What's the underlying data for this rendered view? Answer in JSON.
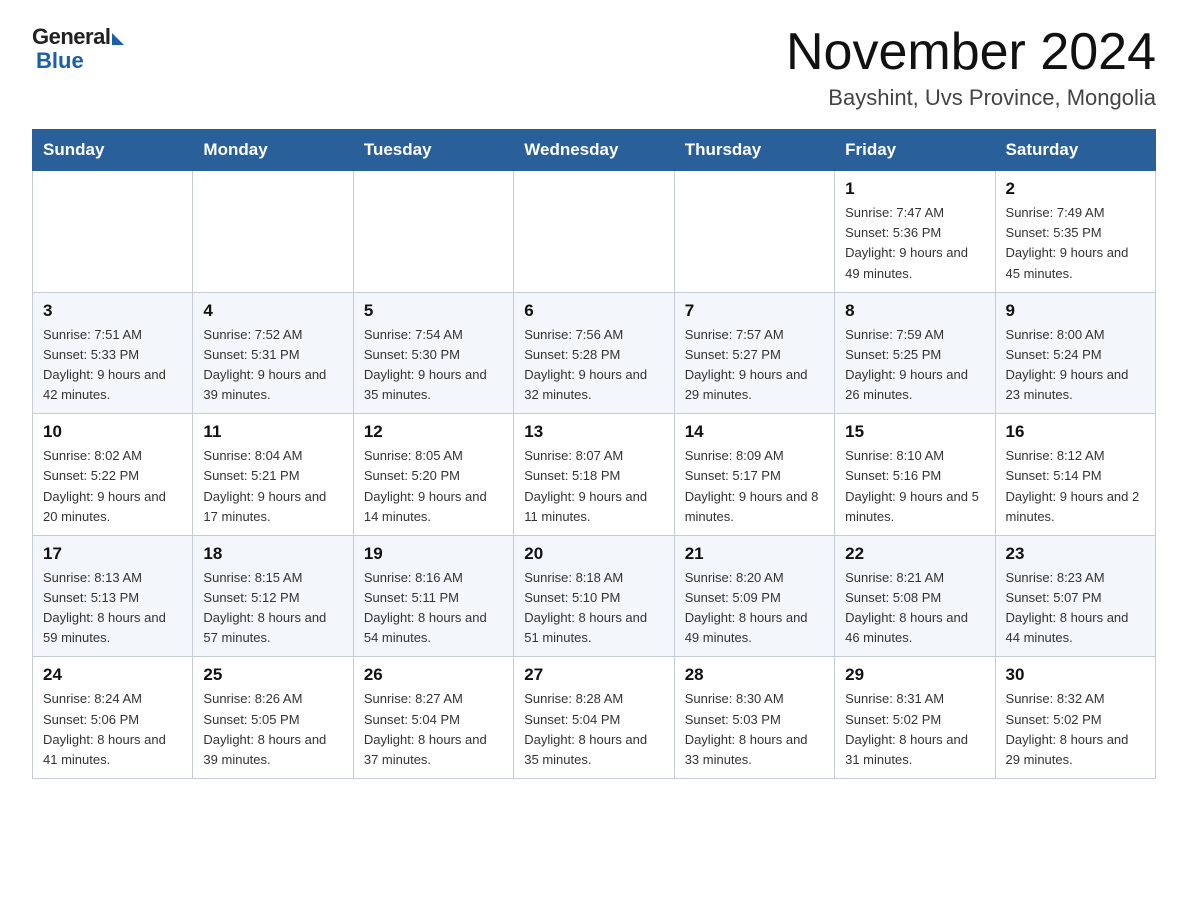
{
  "header": {
    "logo_general": "General",
    "logo_blue": "Blue",
    "month_title": "November 2024",
    "subtitle": "Bayshint, Uvs Province, Mongolia"
  },
  "calendar": {
    "weekdays": [
      "Sunday",
      "Monday",
      "Tuesday",
      "Wednesday",
      "Thursday",
      "Friday",
      "Saturday"
    ],
    "weeks": [
      [
        {
          "day": "",
          "info": ""
        },
        {
          "day": "",
          "info": ""
        },
        {
          "day": "",
          "info": ""
        },
        {
          "day": "",
          "info": ""
        },
        {
          "day": "",
          "info": ""
        },
        {
          "day": "1",
          "info": "Sunrise: 7:47 AM\nSunset: 5:36 PM\nDaylight: 9 hours and 49 minutes."
        },
        {
          "day": "2",
          "info": "Sunrise: 7:49 AM\nSunset: 5:35 PM\nDaylight: 9 hours and 45 minutes."
        }
      ],
      [
        {
          "day": "3",
          "info": "Sunrise: 7:51 AM\nSunset: 5:33 PM\nDaylight: 9 hours and 42 minutes."
        },
        {
          "day": "4",
          "info": "Sunrise: 7:52 AM\nSunset: 5:31 PM\nDaylight: 9 hours and 39 minutes."
        },
        {
          "day": "5",
          "info": "Sunrise: 7:54 AM\nSunset: 5:30 PM\nDaylight: 9 hours and 35 minutes."
        },
        {
          "day": "6",
          "info": "Sunrise: 7:56 AM\nSunset: 5:28 PM\nDaylight: 9 hours and 32 minutes."
        },
        {
          "day": "7",
          "info": "Sunrise: 7:57 AM\nSunset: 5:27 PM\nDaylight: 9 hours and 29 minutes."
        },
        {
          "day": "8",
          "info": "Sunrise: 7:59 AM\nSunset: 5:25 PM\nDaylight: 9 hours and 26 minutes."
        },
        {
          "day": "9",
          "info": "Sunrise: 8:00 AM\nSunset: 5:24 PM\nDaylight: 9 hours and 23 minutes."
        }
      ],
      [
        {
          "day": "10",
          "info": "Sunrise: 8:02 AM\nSunset: 5:22 PM\nDaylight: 9 hours and 20 minutes."
        },
        {
          "day": "11",
          "info": "Sunrise: 8:04 AM\nSunset: 5:21 PM\nDaylight: 9 hours and 17 minutes."
        },
        {
          "day": "12",
          "info": "Sunrise: 8:05 AM\nSunset: 5:20 PM\nDaylight: 9 hours and 14 minutes."
        },
        {
          "day": "13",
          "info": "Sunrise: 8:07 AM\nSunset: 5:18 PM\nDaylight: 9 hours and 11 minutes."
        },
        {
          "day": "14",
          "info": "Sunrise: 8:09 AM\nSunset: 5:17 PM\nDaylight: 9 hours and 8 minutes."
        },
        {
          "day": "15",
          "info": "Sunrise: 8:10 AM\nSunset: 5:16 PM\nDaylight: 9 hours and 5 minutes."
        },
        {
          "day": "16",
          "info": "Sunrise: 8:12 AM\nSunset: 5:14 PM\nDaylight: 9 hours and 2 minutes."
        }
      ],
      [
        {
          "day": "17",
          "info": "Sunrise: 8:13 AM\nSunset: 5:13 PM\nDaylight: 8 hours and 59 minutes."
        },
        {
          "day": "18",
          "info": "Sunrise: 8:15 AM\nSunset: 5:12 PM\nDaylight: 8 hours and 57 minutes."
        },
        {
          "day": "19",
          "info": "Sunrise: 8:16 AM\nSunset: 5:11 PM\nDaylight: 8 hours and 54 minutes."
        },
        {
          "day": "20",
          "info": "Sunrise: 8:18 AM\nSunset: 5:10 PM\nDaylight: 8 hours and 51 minutes."
        },
        {
          "day": "21",
          "info": "Sunrise: 8:20 AM\nSunset: 5:09 PM\nDaylight: 8 hours and 49 minutes."
        },
        {
          "day": "22",
          "info": "Sunrise: 8:21 AM\nSunset: 5:08 PM\nDaylight: 8 hours and 46 minutes."
        },
        {
          "day": "23",
          "info": "Sunrise: 8:23 AM\nSunset: 5:07 PM\nDaylight: 8 hours and 44 minutes."
        }
      ],
      [
        {
          "day": "24",
          "info": "Sunrise: 8:24 AM\nSunset: 5:06 PM\nDaylight: 8 hours and 41 minutes."
        },
        {
          "day": "25",
          "info": "Sunrise: 8:26 AM\nSunset: 5:05 PM\nDaylight: 8 hours and 39 minutes."
        },
        {
          "day": "26",
          "info": "Sunrise: 8:27 AM\nSunset: 5:04 PM\nDaylight: 8 hours and 37 minutes."
        },
        {
          "day": "27",
          "info": "Sunrise: 8:28 AM\nSunset: 5:04 PM\nDaylight: 8 hours and 35 minutes."
        },
        {
          "day": "28",
          "info": "Sunrise: 8:30 AM\nSunset: 5:03 PM\nDaylight: 8 hours and 33 minutes."
        },
        {
          "day": "29",
          "info": "Sunrise: 8:31 AM\nSunset: 5:02 PM\nDaylight: 8 hours and 31 minutes."
        },
        {
          "day": "30",
          "info": "Sunrise: 8:32 AM\nSunset: 5:02 PM\nDaylight: 8 hours and 29 minutes."
        }
      ]
    ]
  }
}
